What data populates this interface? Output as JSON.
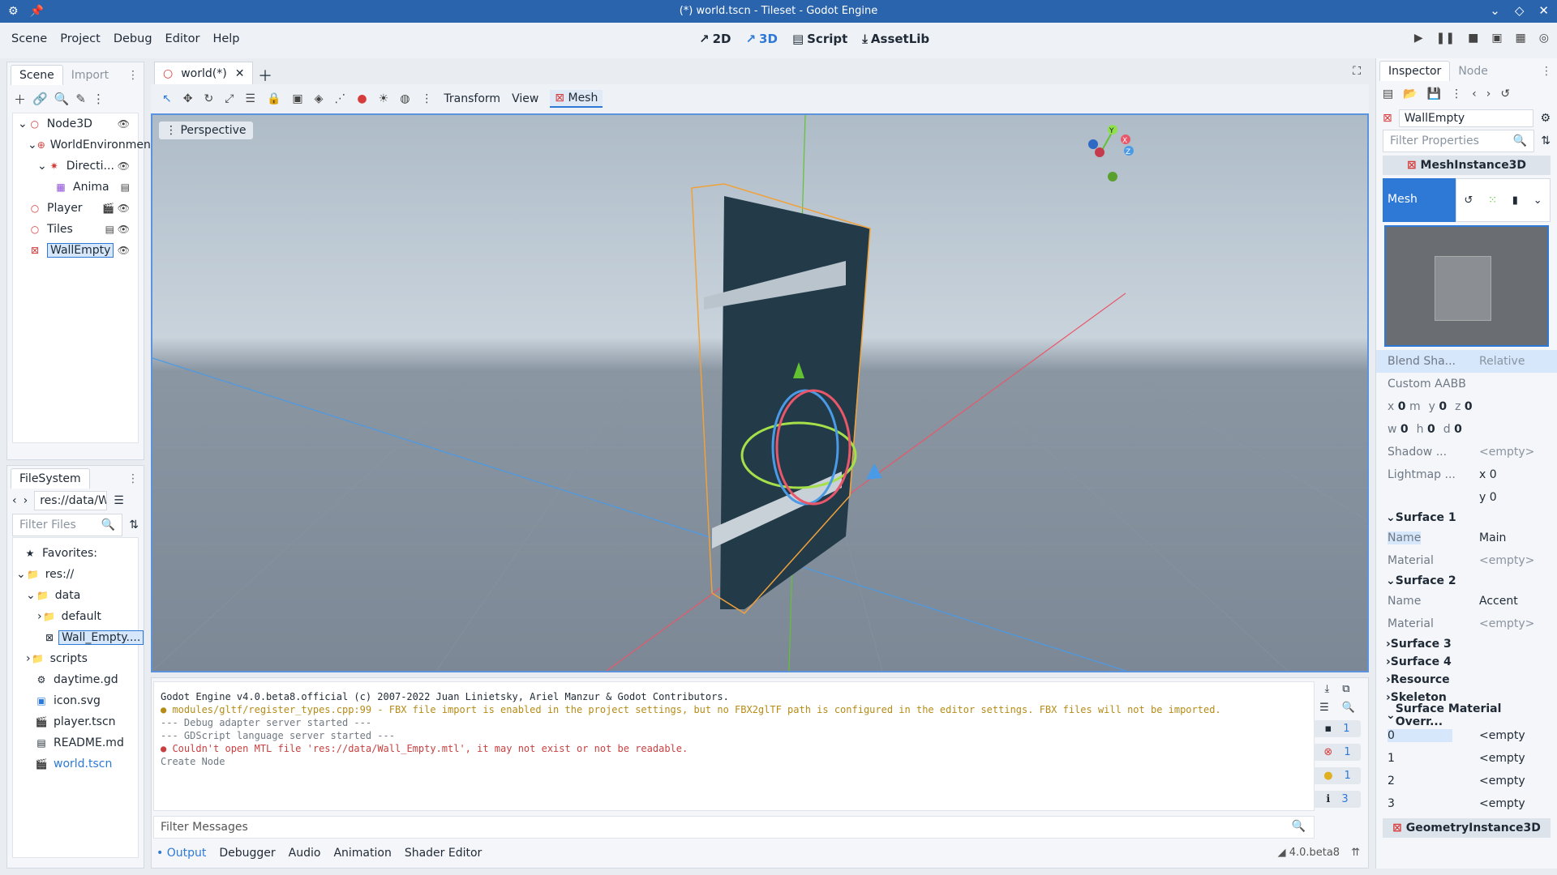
{
  "window": {
    "title": "(*) world.tscn - Tileset - Godot Engine"
  },
  "menu": [
    "Scene",
    "Project",
    "Debug",
    "Editor",
    "Help"
  ],
  "modes": {
    "m2d": "2D",
    "m3d": "3D",
    "script": "Script",
    "assetlib": "AssetLib"
  },
  "scene_panel": {
    "tabs": [
      "Scene",
      "Import"
    ],
    "nodes": [
      {
        "label": "Node3D",
        "icon": "node3d-icon"
      },
      {
        "label": "WorldEnvironment",
        "icon": "world-environment-icon"
      },
      {
        "label": "Directi...",
        "icon": "directional-light-icon"
      },
      {
        "label": "Anima",
        "icon": "animation-player-icon"
      },
      {
        "label": "Player",
        "icon": "node3d-icon"
      },
      {
        "label": "Tiles",
        "icon": "node3d-icon"
      },
      {
        "label": "WallEmpty",
        "icon": "mesh-instance-icon"
      }
    ]
  },
  "filesystem": {
    "tab": "FileSystem",
    "path": "res://data/W",
    "filter_placeholder": "Filter Files",
    "items": [
      "Favorites:",
      "res://",
      "data",
      "default",
      "Wall_Empty....",
      "scripts",
      "daytime.gd",
      "icon.svg",
      "player.tscn",
      "README.md",
      "world.tscn"
    ]
  },
  "editor": {
    "tab": "world(*)",
    "toolbar": {
      "transform": "Transform",
      "view": "View",
      "mesh": "Mesh"
    },
    "viewport_label": "Perspective",
    "gizmo_axes": [
      "Y",
      "X",
      "Z"
    ]
  },
  "output": {
    "lines": [
      {
        "text": "Godot Engine v4.0.beta8.official (c) 2007-2022 Juan Linietsky, Ariel Manzur & Godot Contributors.",
        "kind": "normal"
      },
      {
        "text": "modules/gltf/register_types.cpp:99 - FBX file import is enabled in the project settings, but no FBX2glTF path is configured in the editor settings. FBX files will not be imported.",
        "kind": "warn"
      },
      {
        "text": "--- Debug adapter server started ---",
        "kind": "dim"
      },
      {
        "text": "--- GDScript language server started ---",
        "kind": "dim"
      },
      {
        "text": "Couldn't open MTL file 'res://data/Wall_Empty.mtl', it may not exist or not be readable.",
        "kind": "err"
      },
      {
        "text": "Create Node",
        "kind": "dim"
      }
    ],
    "filter_placeholder": "Filter Messages",
    "counts": {
      "messages": "1",
      "errors": "1",
      "warnings": "1",
      "info": "3"
    },
    "tabs": [
      "Output",
      "Debugger",
      "Audio",
      "Animation",
      "Shader Editor"
    ],
    "version": "4.0.beta8"
  },
  "inspector": {
    "tabs": [
      "Inspector",
      "Node"
    ],
    "object": "WallEmpty",
    "filter_placeholder": "Filter Properties",
    "section": "MeshInstance3D",
    "mesh_label": "Mesh",
    "props": {
      "blend_shape": {
        "label": "Blend Sha...",
        "value": "Relative"
      },
      "custom_aabb": "Custom AABB",
      "aabb": {
        "x": "0",
        "y": "0",
        "z": "0",
        "w": "0",
        "h": "0",
        "d": "0",
        "unit": "m"
      },
      "shadow": {
        "label": "Shadow ...",
        "value": "<empty>"
      },
      "lightmap": {
        "label": "Lightmap ...",
        "x": "0",
        "y": "0"
      }
    },
    "surface1": {
      "title": "Surface 1",
      "name_label": "Name",
      "name": "Main",
      "material_label": "Material",
      "material": "<empty>"
    },
    "surface2": {
      "title": "Surface 2",
      "name_label": "Name",
      "name": "Accent",
      "material_label": "Material",
      "material": "<empty>"
    },
    "collapsed": [
      "Surface 3",
      "Surface 4",
      "Resource",
      "Skeleton"
    ],
    "overrides_title": "Surface Material Overr...",
    "overrides": [
      {
        "index": "0",
        "value": "<empty"
      },
      {
        "index": "1",
        "value": "<empty"
      },
      {
        "index": "2",
        "value": "<empty"
      },
      {
        "index": "3",
        "value": "<empty"
      }
    ],
    "geometry_section": "GeometryInstance3D"
  }
}
